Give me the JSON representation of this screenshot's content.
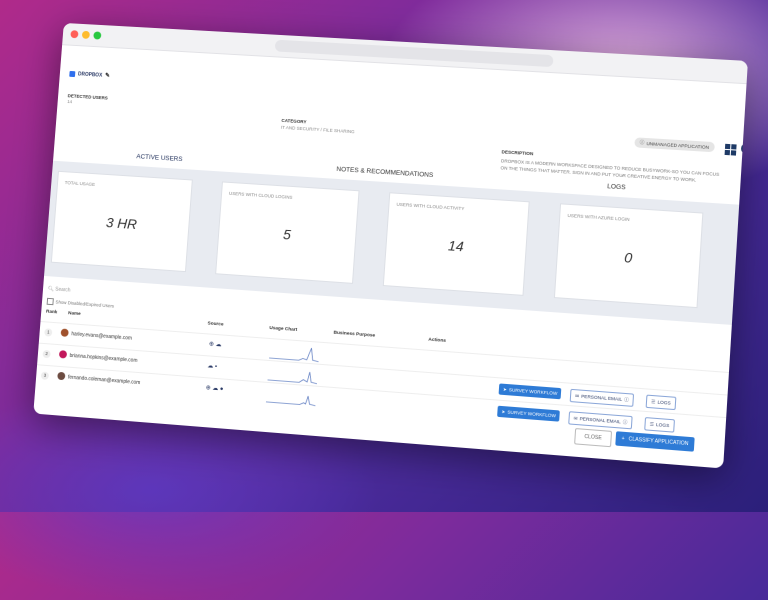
{
  "app": {
    "name": "DROPBOX"
  },
  "meta": {
    "detected_users_label": "DETECTED USERS",
    "detected_users_value": "14",
    "category_label": "CATEGORY",
    "category_value": "IT AND SECURITY / FILE SHARING",
    "description_label": "DESCRIPTION",
    "description_value": "DROPBOX IS A MODERN WORKSPACE DESIGNED TO REDUCE BUSYWORK-SO YOU CAN FOCUS ON THE THINGS THAT MATTER. SIGN IN AND PUT YOUR CREATIVE ENERGY TO WORK."
  },
  "badge": {
    "label": "UNMANAGED APPLICATION"
  },
  "tabs": [
    "ACTIVE USERS",
    "NOTES & RECOMMENDATIONS",
    "LOGS"
  ],
  "stats": [
    {
      "label": "TOTAL USAGE",
      "value": "3 HR"
    },
    {
      "label": "USERS WITH CLOUD LOGINS",
      "value": "5"
    },
    {
      "label": "USERS WITH CLOUD ACTIVITY",
      "value": "14"
    },
    {
      "label": "USERS WITH AZURE LOGIN",
      "value": "0"
    }
  ],
  "table": {
    "search_placeholder": "Search",
    "show_disabled_label": "Show Disabled/Expired Users",
    "headers": {
      "rank": "Rank",
      "name": "Name",
      "source": "Source",
      "usage_chart": "Usage Chart",
      "business_purpose": "Business Purpose",
      "actions": "Actions"
    },
    "rows": [
      {
        "rank": "1",
        "email": "harley.evans@example.com",
        "avatar_color": "#a0522d"
      },
      {
        "rank": "2",
        "email": "brianna.hopkins@example.com",
        "avatar_color": "#c2185b"
      },
      {
        "rank": "3",
        "email": "fernando.coleman@example.com",
        "avatar_color": "#6d4c41"
      }
    ],
    "actions": {
      "survey": "SURVEY WORKFLOW",
      "email": "PERSONAL EMAIL",
      "logs": "LOGS"
    }
  },
  "footer": {
    "close": "CLOSE",
    "classify": "CLASSIFY APPLICATION"
  }
}
